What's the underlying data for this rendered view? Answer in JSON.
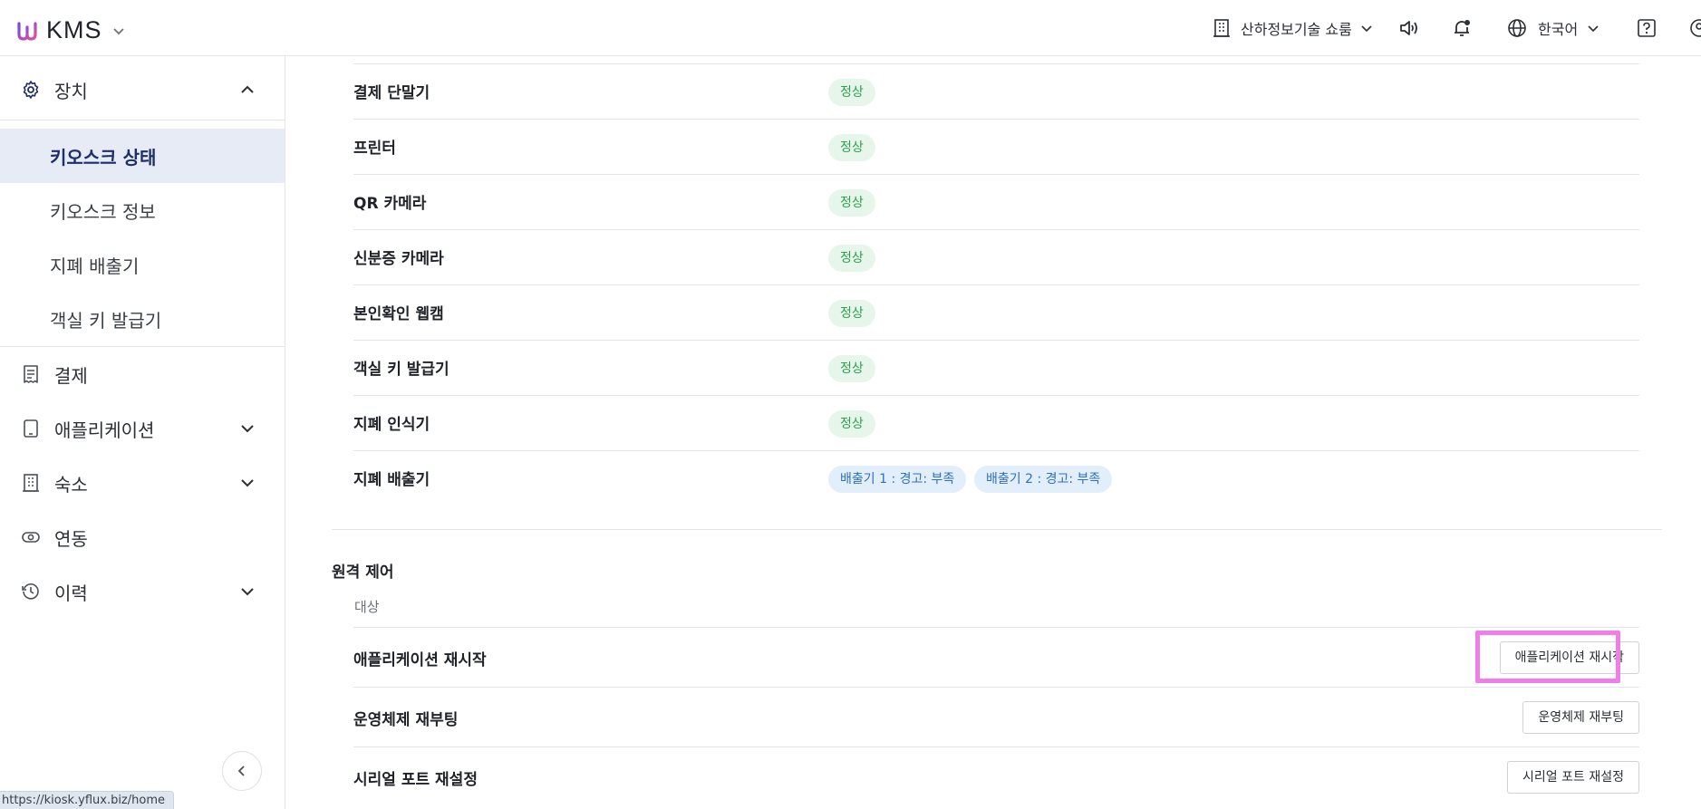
{
  "header": {
    "app_name": "KMS",
    "store_name": "산하정보기술 쇼룸",
    "language": "한국어",
    "icons": [
      "building-icon",
      "chevron-down-icon",
      "speaker-icon",
      "bell-icon",
      "globe-icon",
      "help-icon",
      "account-icon"
    ]
  },
  "sidebar": {
    "device_group": "장치",
    "sub_items": [
      "키오스크 상태",
      "키오스크 정보",
      "지폐 배출기",
      "객실 키 발급기"
    ],
    "groups": [
      "결제",
      "애플리케이션",
      "숙소",
      "연동",
      "이력"
    ]
  },
  "status_url": "https://kiosk.yflux.biz/home",
  "devices": [
    {
      "name": "결제 단말기",
      "statuses": [
        "정상"
      ]
    },
    {
      "name": "프린터",
      "statuses": [
        "정상"
      ]
    },
    {
      "name": "QR 카메라",
      "statuses": [
        "정상"
      ]
    },
    {
      "name": "신분증 카메라",
      "statuses": [
        "정상"
      ]
    },
    {
      "name": "본인확인 웹캠",
      "statuses": [
        "정상"
      ]
    },
    {
      "name": "객실 키 발급기",
      "statuses": [
        "정상"
      ]
    },
    {
      "name": "지폐 인식기",
      "statuses": [
        "정상"
      ]
    },
    {
      "name": "지폐 배출기",
      "statuses": [
        "배출기 1 : 경고: 부족",
        "배출기 2 : 경고: 부족"
      ]
    }
  ],
  "remote": {
    "title": "원격 제어",
    "column_header": "대상",
    "rows": [
      {
        "name": "애플리케이션 재시작",
        "button": "애플리케이션 재시작"
      },
      {
        "name": "운영체제 재부팅",
        "button": "운영체제 재부팅"
      },
      {
        "name": "시리얼 포트 재설정",
        "button": "시리얼 포트 재설정"
      }
    ]
  },
  "colors": {
    "ok_bg": "#e6f6ea",
    "ok_text": "#2f9e4f",
    "warn_bg": "#e3eefb",
    "warn_text": "#2d6fc3",
    "active_nav_bg": "#e6ebf5",
    "highlight": "#f07ee6"
  }
}
